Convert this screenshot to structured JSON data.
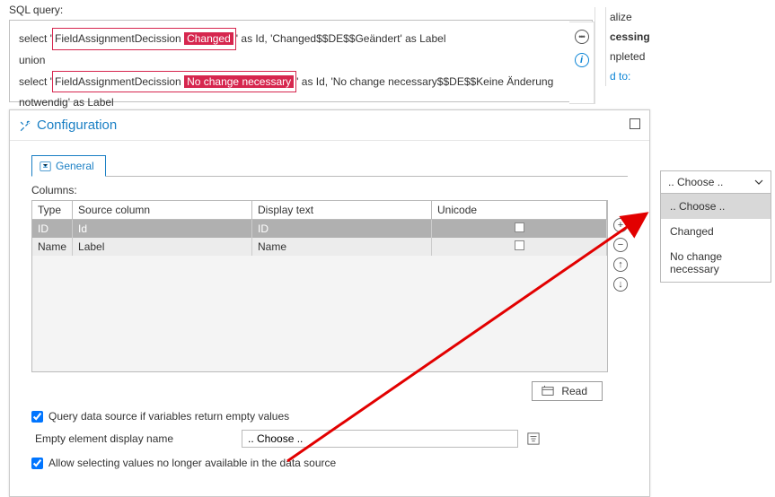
{
  "sql": {
    "label": "SQL query:",
    "line1_a": "select '",
    "line1_b": "FieldAssignmentDecission",
    "line1_c": "Changed",
    "line1_d": "' as Id, 'Changed$$DE$$Geändert' as Label",
    "line2": "union",
    "line3_a": "select '",
    "line3_b": "FieldAssignmentDecission",
    "line3_c": "No change necessary",
    "line3_d": "' as Id, 'No change necessary$$DE$$Keine Änderung",
    "line4": "notwendig' as Label"
  },
  "rfrag": {
    "r1": "alize",
    "r2": "cessing",
    "r3": "npleted",
    "r4": "d to:"
  },
  "config": {
    "title": "Configuration",
    "tab_general": "General",
    "columns_label": "Columns:",
    "read_label": "Read",
    "opt_query_ds": "Query data source if variables return empty values",
    "empty_label": "Empty element display name",
    "empty_value": ".. Choose ..",
    "opt_allow": "Allow selecting values no longer available in the data source"
  },
  "table": {
    "headers": {
      "type": "Type",
      "src": "Source column",
      "disp": "Display text",
      "uni": "Unicode"
    },
    "rows": [
      {
        "type": "ID",
        "src": "Id",
        "disp": "ID"
      },
      {
        "type": "Name",
        "src": "Label",
        "disp": "Name"
      }
    ]
  },
  "dropdown": {
    "selected": ".. Choose ..",
    "items": [
      ".. Choose ..",
      "Changed",
      "No change necessary"
    ]
  }
}
